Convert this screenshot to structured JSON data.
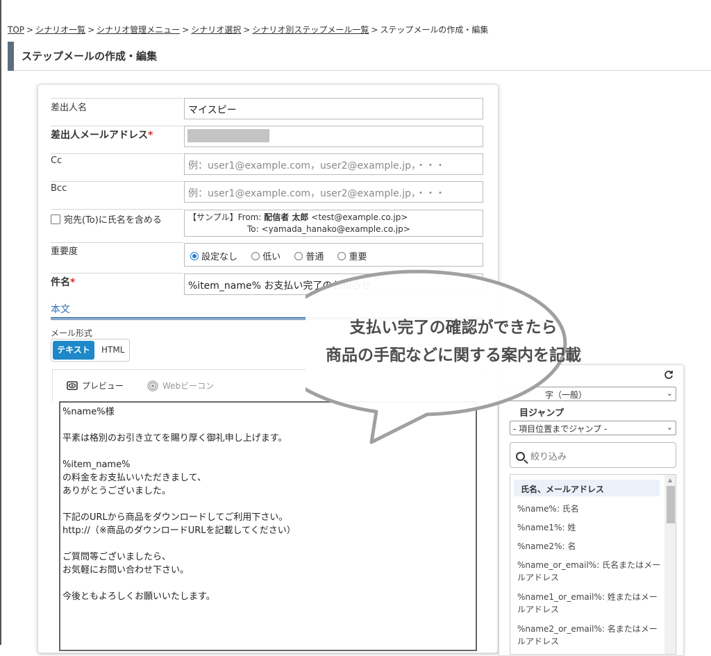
{
  "breadcrumb": {
    "items": [
      "TOP",
      "シナリオ一覧",
      "シナリオ管理メニュー",
      "シナリオ選択",
      "シナリオ別ステップメール一覧"
    ],
    "current": "ステップメールの作成・編集",
    "separator": ">"
  },
  "page_title": "ステップメールの作成・編集",
  "form": {
    "sender_name": {
      "label": "差出人名",
      "value": "マイスピー"
    },
    "sender_email": {
      "label": "差出人メールアドレス",
      "required_mark": "*"
    },
    "cc": {
      "label": "Cc",
      "placeholder": "例：user1@example.com，user2@example.jp，・・・"
    },
    "bcc": {
      "label": "Bcc",
      "placeholder": "例：user1@example.com，user2@example.jp，・・・"
    },
    "include_name": {
      "label": "宛先(To)に氏名を含める",
      "checked": false,
      "sample_prefix": "【サンプル】From:",
      "sample_from_name": "配信者 太郎",
      "sample_from_addr": "<test@example.co.jp>",
      "sample_to_label": "To:",
      "sample_to_addr": "<yamada_hanako@example.co.jp>"
    },
    "priority": {
      "label": "重要度",
      "options": [
        "設定なし",
        "低い",
        "普通",
        "重要"
      ],
      "selected": "設定なし"
    },
    "subject": {
      "label": "件名",
      "required_mark": "*",
      "value": "%item_name% お支払い完了のお知らせ"
    }
  },
  "body_section": {
    "heading": "本文",
    "format_label": "メール形式",
    "format_options": [
      "テキスト",
      "HTML"
    ],
    "format_selected": "テキスト"
  },
  "editor": {
    "tabs": [
      "プレビュー",
      "Webビーコン"
    ],
    "lines": [
      "%name%様",
      "",
      "平素は格別のお引き立てを賜り厚く御礼申し上げます。",
      "",
      "%item_name%",
      "の料金をお支払いいただきまして、",
      "ありがとうございました。",
      "",
      "下記のURLから商品をダウンロードしてご利用下さい。",
      "http://（※商品のダウンロードURLを記載してください）",
      "",
      "ご質問等ございましたら、",
      "お気軽にお問い合わせ下さい。",
      "",
      "今後ともよろしくお願いいたします。"
    ]
  },
  "side": {
    "category_select": "置換文字（一般）",
    "category_select_visible": "字（一般）",
    "jump_label": "項目ジャンプ",
    "jump_label_visible": "目ジャンプ",
    "jump_select": "- 項目位置までジャンプ -",
    "filter_placeholder": "絞り込み",
    "group_heading": "氏名、メールアドレス",
    "variables": [
      "%name%: 氏名",
      "%name1%: 姓",
      "%name2%: 名",
      "%name_or_email%: 氏名またはメールアドレス",
      "%name1_or_email%: 姓またはメールアドレス",
      "%name2_or_email%: 名またはメールアドレス"
    ]
  },
  "callout": {
    "line1": "支払い完了の確認ができたら",
    "line2": "商品の手配などに関する案内を記載"
  },
  "colors": {
    "accent": "#1e88c8",
    "required": "#d9302c",
    "heading_blue": "#2a6fb7",
    "header_bar": "#5d6e7d"
  }
}
